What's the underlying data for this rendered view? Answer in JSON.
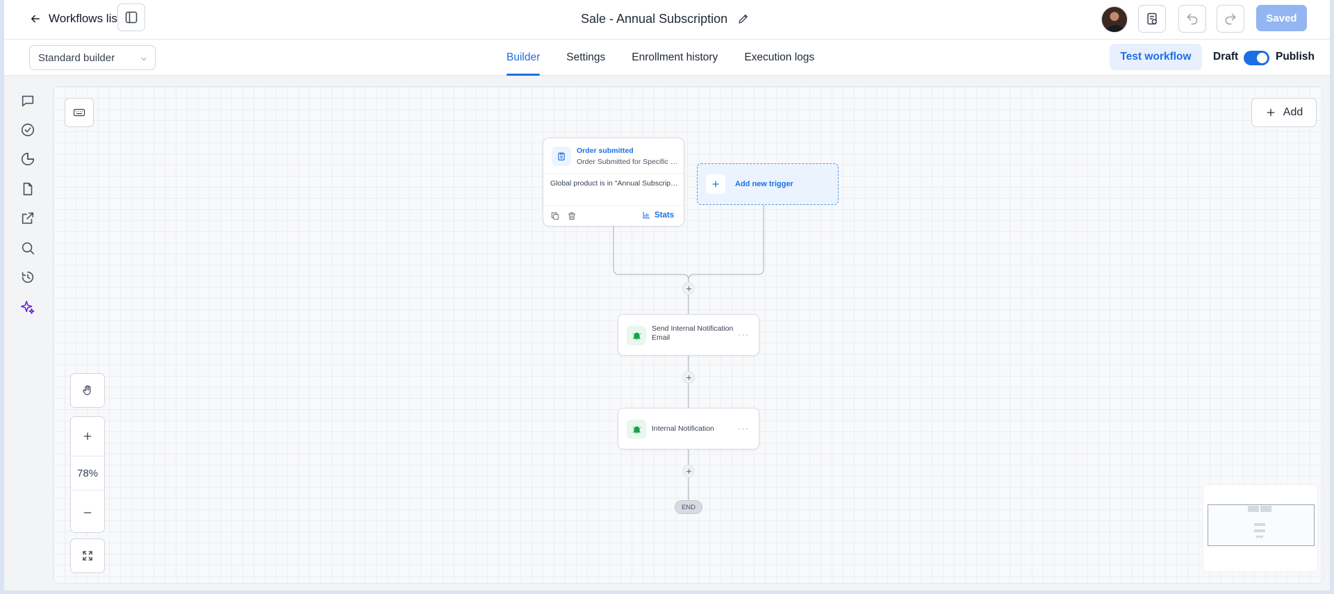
{
  "header": {
    "back_label": "Workflows list",
    "title": "Sale - Annual Subscription",
    "saved_label": "Saved"
  },
  "subbar": {
    "builder_mode": "Standard builder",
    "tabs": [
      {
        "label": "Builder",
        "active": true
      },
      {
        "label": "Settings",
        "active": false
      },
      {
        "label": "Enrollment history",
        "active": false
      },
      {
        "label": "Execution logs",
        "active": false
      }
    ],
    "test_workflow_label": "Test workflow",
    "draft_label": "Draft",
    "publish_label": "Publish",
    "publish_toggle_on": true
  },
  "rail": {
    "icons": [
      "chat-icon",
      "check-circle-icon",
      "pie-chart-icon",
      "file-icon",
      "external-link-icon",
      "search-icon",
      "history-icon",
      "sparkles-icon"
    ]
  },
  "canvas": {
    "add_label": "Add",
    "zoom_level": "78%",
    "trigger": {
      "title": "Order submitted",
      "subtitle": "Order Submitted for Specific Products",
      "filter": "Global product is in \"Annual Subscription\"",
      "stats_label": "Stats"
    },
    "add_trigger_label": "Add new trigger",
    "actions": [
      {
        "label": "Send Internal Notification Email"
      },
      {
        "label": "Internal Notification"
      }
    ],
    "end_label": "END"
  },
  "colors": {
    "accent": "#1d6fe5",
    "saved_button": "#93b5f2",
    "action_icon": "#16a34a"
  }
}
